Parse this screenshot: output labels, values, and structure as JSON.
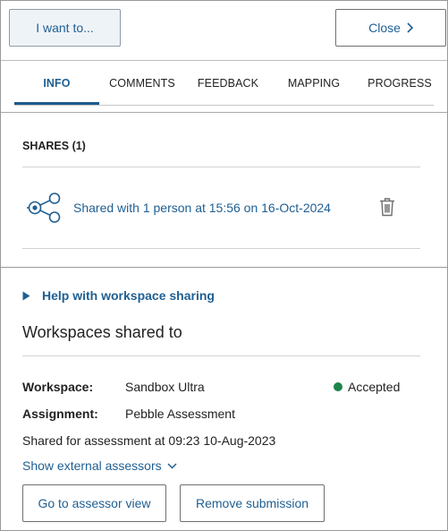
{
  "topbar": {
    "want_label": "I want to...",
    "close_label": "Close"
  },
  "tabs": [
    {
      "label": "INFO",
      "active": true
    },
    {
      "label": "COMMENTS",
      "active": false
    },
    {
      "label": "FEEDBACK",
      "active": false
    },
    {
      "label": "MAPPING",
      "active": false
    },
    {
      "label": "PROGRESS",
      "active": false
    }
  ],
  "shares": {
    "title": "SHARES (1)",
    "items": [
      {
        "text": "Shared with 1 person at 15:56 on 16-Oct-2024",
        "icon": "share-network-icon",
        "action_icon": "trash-icon"
      }
    ]
  },
  "help": {
    "label": "Help with workspace sharing",
    "icon": "triangle-right-icon"
  },
  "workspaces": {
    "title": "Workspaces shared to",
    "workspace_label": "Workspace:",
    "workspace_value": "Sandbox Ultra",
    "status": "Accepted",
    "status_color": "#1e8449",
    "assignment_label": "Assignment:",
    "assignment_value": "Pebble Assessment",
    "shared_for": "Shared for assessment at 09:23 10-Aug-2023",
    "external_link": "Show external assessors",
    "assessor_button": "Go to assessor view",
    "remove_button": "Remove submission"
  },
  "colors": {
    "accent": "#1f5f92",
    "tab_underline": "#1d5b8c",
    "want_button_bg": "#eef3f8"
  }
}
